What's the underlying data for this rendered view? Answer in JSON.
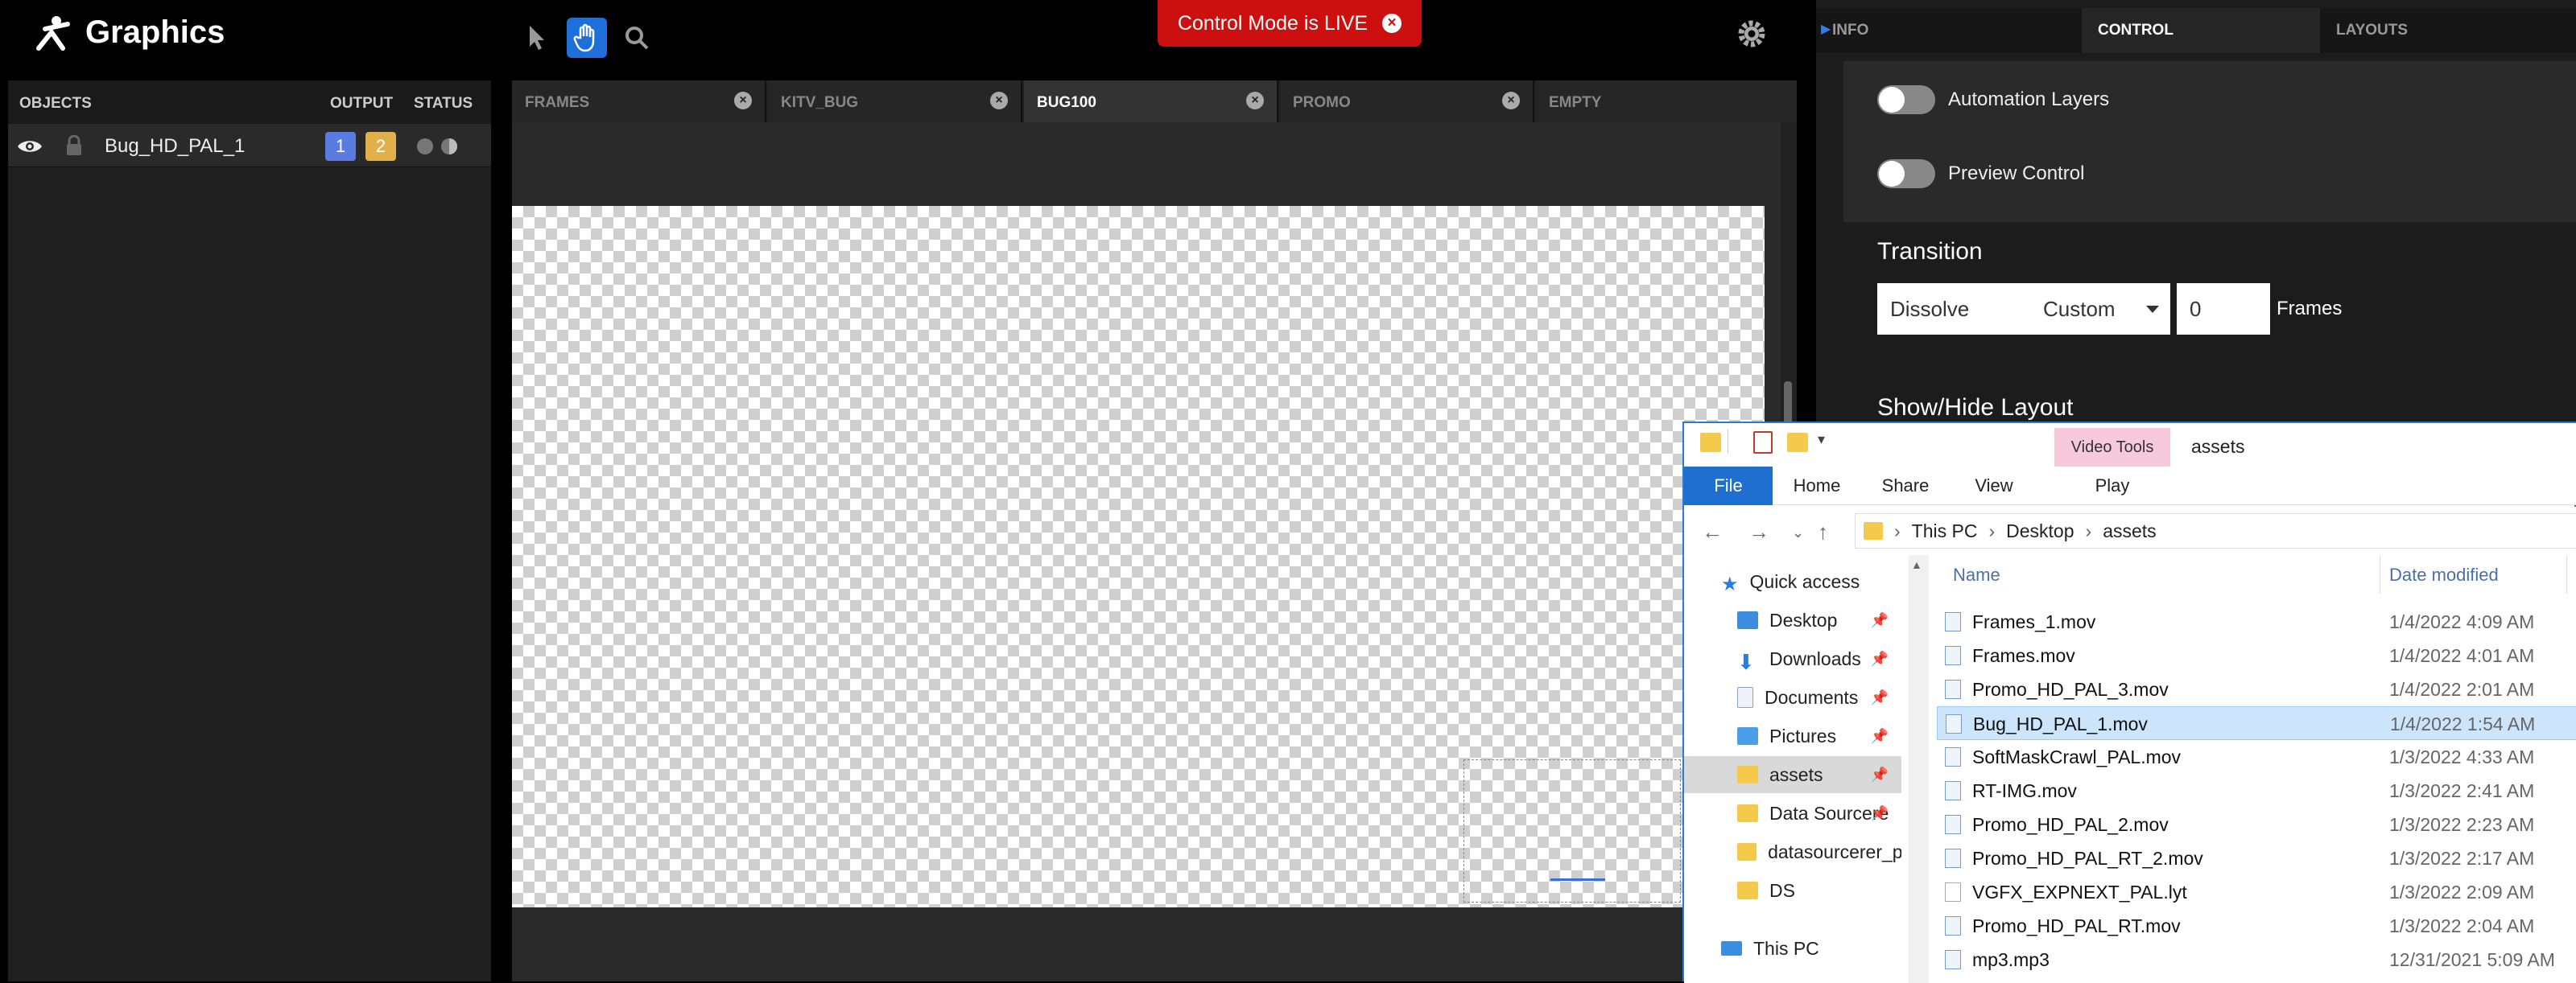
{
  "app": {
    "title": "Graphics",
    "live_banner": "Control Mode is LIVE"
  },
  "objects": {
    "headers": {
      "objects": "OBJECTS",
      "output": "OUTPUT",
      "status": "STATUS"
    },
    "rows": [
      {
        "name": "Bug_HD_PAL_1",
        "outputs": [
          "1",
          "2"
        ]
      }
    ]
  },
  "frame_tabs": [
    {
      "label": "FRAMES"
    },
    {
      "label": "KITV_BUG"
    },
    {
      "label": "BUG100",
      "active": true
    },
    {
      "label": "PROMO"
    },
    {
      "label": "EMPTY"
    }
  ],
  "right_panel": {
    "tabs": {
      "info": "INFO",
      "control": "CONTROL",
      "layouts": "LAYOUTS"
    },
    "toggles": {
      "automation": "Automation Layers",
      "preview": "Preview Control"
    },
    "transition": {
      "title": "Transition",
      "type": "Dissolve",
      "curve": "Custom",
      "frames": "0",
      "frames_label": "Frames"
    },
    "show_hide": "Show/Hide Layout"
  },
  "explorer": {
    "title": "assets",
    "video_tools": "Video Tools",
    "ribbon": {
      "file": "File",
      "home": "Home",
      "share": "Share",
      "view": "View",
      "play": "Play"
    },
    "path": [
      "This PC",
      "Desktop",
      "assets"
    ],
    "nav": [
      {
        "label": "Quick access",
        "icon": "star"
      },
      {
        "label": "Desktop",
        "icon": "desk",
        "pin": true
      },
      {
        "label": "Downloads",
        "icon": "down",
        "pin": true
      },
      {
        "label": "Documents",
        "icon": "doc",
        "pin": true
      },
      {
        "label": "Pictures",
        "icon": "pic",
        "pin": true
      },
      {
        "label": "assets",
        "icon": "folder",
        "pin": true,
        "selected": true
      },
      {
        "label": "Data Sourcere",
        "icon": "folder",
        "pin": true
      },
      {
        "label": "datasourcerer_ps",
        "icon": "folder"
      },
      {
        "label": "DS",
        "icon": "folder"
      },
      {
        "label": "This PC",
        "icon": "pc"
      }
    ],
    "columns": {
      "name": "Name",
      "date": "Date modified"
    },
    "files": [
      {
        "name": "Frames_1.mov",
        "date": "1/4/2022 4:09 AM"
      },
      {
        "name": "Frames.mov",
        "date": "1/4/2022 4:01 AM"
      },
      {
        "name": "Promo_HD_PAL_3.mov",
        "date": "1/4/2022 2:01 AM"
      },
      {
        "name": "Bug_HD_PAL_1.mov",
        "date": "1/4/2022 1:54 AM",
        "selected": true
      },
      {
        "name": "SoftMaskCrawl_PAL.mov",
        "date": "1/3/2022 4:33 AM"
      },
      {
        "name": "RT-IMG.mov",
        "date": "1/3/2022 2:41 AM"
      },
      {
        "name": "Promo_HD_PAL_2.mov",
        "date": "1/3/2022 2:23 AM"
      },
      {
        "name": "Promo_HD_PAL_RT_2.mov",
        "date": "1/3/2022 2:17 AM"
      },
      {
        "name": "VGFX_EXPNEXT_PAL.lyt",
        "date": "1/3/2022 2:09 AM"
      },
      {
        "name": "Promo_HD_PAL_RT.mov",
        "date": "1/3/2022 2:04 AM"
      },
      {
        "name": "mp3.mp3",
        "date": "12/31/2021 5:09 AM"
      }
    ]
  }
}
